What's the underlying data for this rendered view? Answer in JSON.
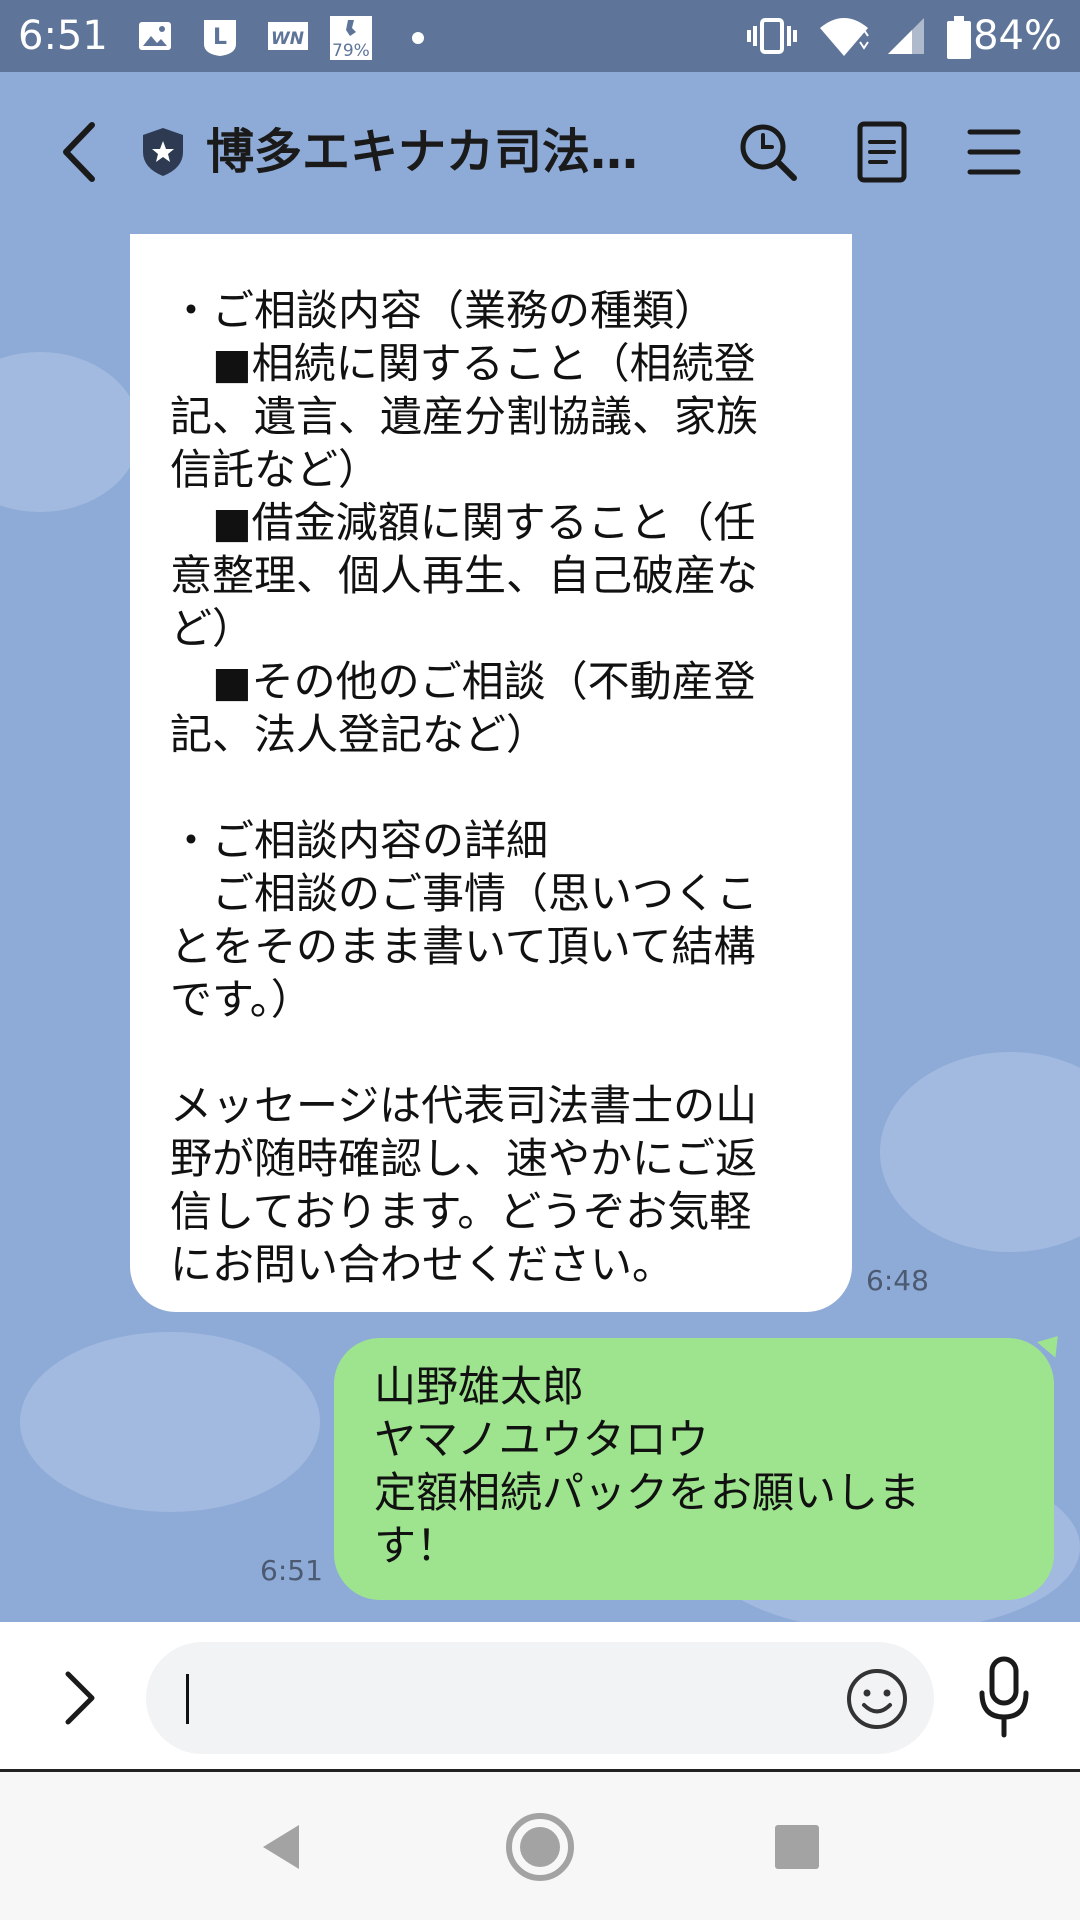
{
  "status_bar": {
    "time": "6:51",
    "notification_badge": "79%",
    "battery_percent": "84%",
    "icons": [
      "image-icon",
      "line-icon",
      "weathernews-icon",
      "percent-badge-icon",
      "dot-icon",
      "vibrate-icon",
      "wifi-icon",
      "signal-icon",
      "battery-icon"
    ]
  },
  "header": {
    "title": "博多エキナカ司法…",
    "back_icon": "chevron-left-icon",
    "badge_icon": "official-shield-icon",
    "actions": [
      "search-icon",
      "note-icon",
      "menu-icon"
    ]
  },
  "messages": [
    {
      "direction": "incoming",
      "text": "・ご相談内容（業務の種類）\n　■相続に関すること（相続登\n記、遺言、遺産分割協議、家族\n信託など）\n　■借金減額に関すること（任\n意整理、個人再生、自己破産な\nど）\n　■その他のご相談（不動産登\n記、法人登記など）\n\n・ご相談内容の詳細\n　ご相談のご事情（思いつくこ\nとをそのまま書いて頂いて結構\nです。）\n\nメッセージは代表司法書士の山\n野が随時確認し、速やかにご返\n信しております。どうぞお気軽\nにお問い合わせください。",
      "time": "6:48"
    },
    {
      "direction": "outgoing",
      "text": "山野雄太郎\nヤマノユウタロウ\n定額相続パックをお願いしま\nす！",
      "time": "6:51"
    }
  ],
  "input_bar": {
    "value": "",
    "icons": [
      "chevron-right-icon",
      "emoji-icon",
      "microphone-icon"
    ]
  },
  "nav_bar": {
    "icons": [
      "back-triangle-icon",
      "home-circle-icon",
      "recents-square-icon"
    ]
  },
  "colors": {
    "chat_background": "#8eabd8",
    "status_bar": "#5e7599",
    "incoming_bubble": "#ffffff",
    "outgoing_bubble": "#9ee48e"
  }
}
